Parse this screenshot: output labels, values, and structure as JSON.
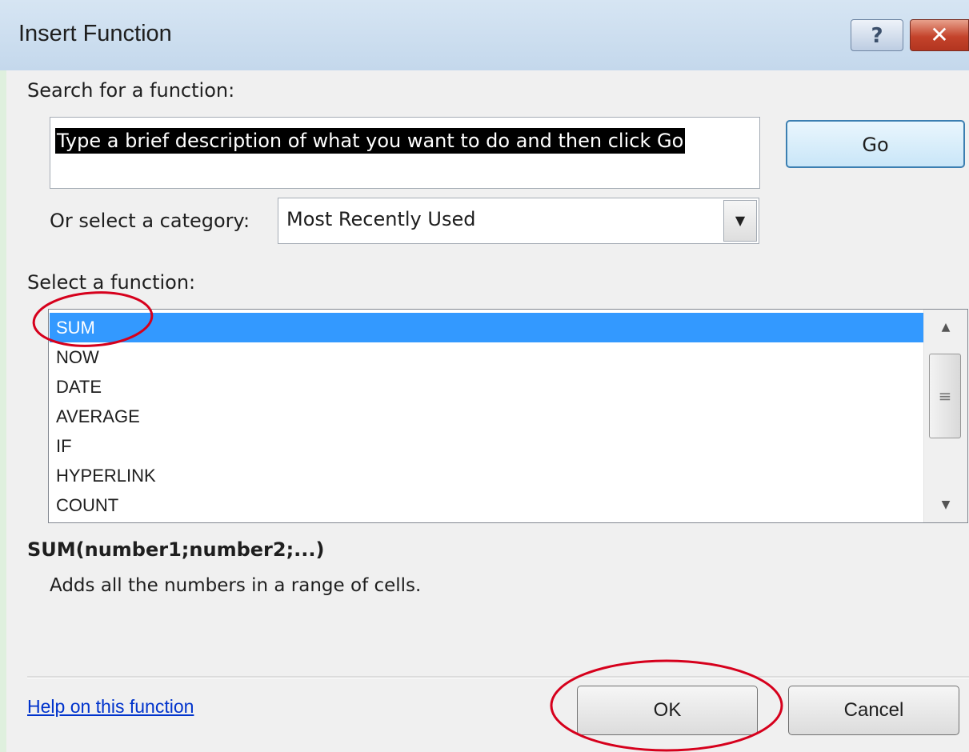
{
  "dialog": {
    "title": "Insert Function",
    "help_button": "?",
    "close_button": "✕"
  },
  "search": {
    "label": "Search for a function:",
    "value": "Type a brief description of what you want to do and then click Go",
    "go_button": "Go"
  },
  "category": {
    "label": "Or select a category:",
    "selected": "Most Recently Used"
  },
  "functions": {
    "label": "Select a function:",
    "items": [
      "SUM",
      "NOW",
      "DATE",
      "AVERAGE",
      "IF",
      "HYPERLINK",
      "COUNT"
    ],
    "selected": "SUM"
  },
  "details": {
    "syntax": "SUM(number1;number2;...)",
    "description": "Adds all the numbers in a range of cells."
  },
  "footer": {
    "help_link": "Help on this function",
    "ok_button": "OK",
    "cancel_button": "Cancel"
  },
  "colors": {
    "selection": "#3399ff",
    "annotation": "#d6001c",
    "link": "#0033cc"
  }
}
